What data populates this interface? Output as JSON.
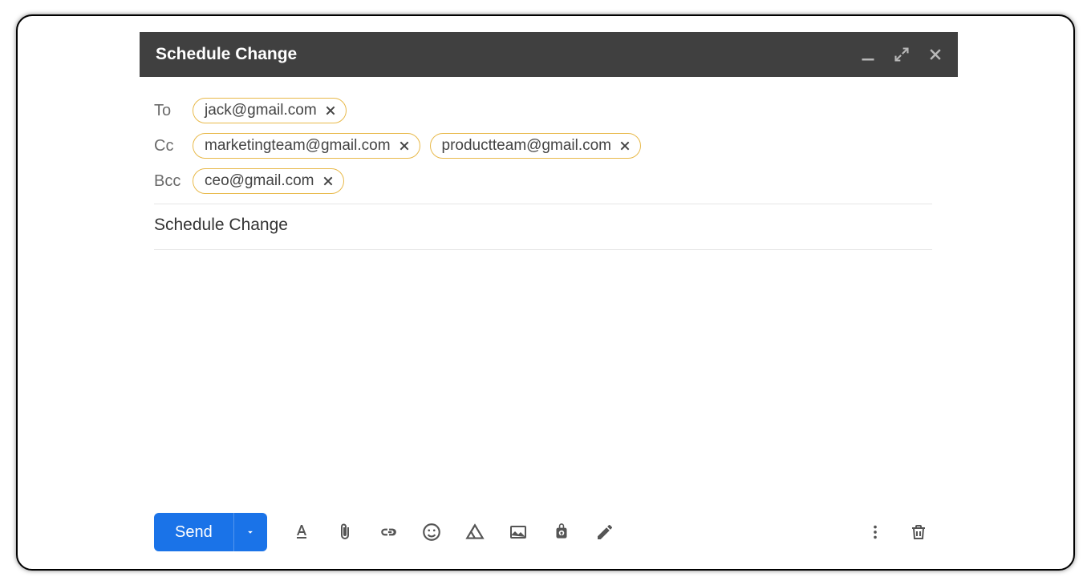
{
  "header": {
    "title": "Schedule Change"
  },
  "fields": {
    "to_label": "To",
    "cc_label": "Cc",
    "bcc_label": "Bcc",
    "to": [
      "jack@gmail.com"
    ],
    "cc": [
      "marketingteam@gmail.com",
      "productteam@gmail.com"
    ],
    "bcc": [
      "ceo@gmail.com"
    ]
  },
  "subject": "Schedule Change",
  "toolbar": {
    "send_label": "Send"
  }
}
